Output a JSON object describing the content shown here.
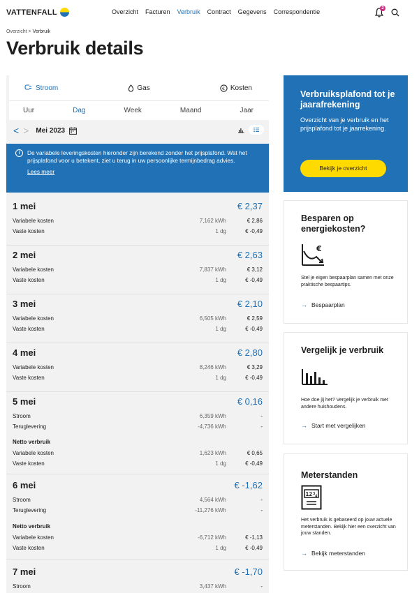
{
  "brand": {
    "name": "VATTENFALL"
  },
  "nav": [
    "Overzicht",
    "Facturen",
    "Verbruik",
    "Contract",
    "Gegevens",
    "Correspondentie"
  ],
  "notifications": {
    "count": "2"
  },
  "breadcrumb": {
    "parent": "Overzicht",
    "sep": ">",
    "current": "Verbruik"
  },
  "title": "Verbruik details",
  "energy_tabs": [
    "Stroom",
    "Gas",
    "Kosten"
  ],
  "period_tabs": [
    "Uur",
    "Dag",
    "Week",
    "Maand",
    "Jaar"
  ],
  "date": {
    "month": "Mei 2023",
    "prev": "<",
    "next": ">"
  },
  "info": {
    "text": "De variabele leveringskosten hieronder zijn berekend zonder het prijsplafond. Wat het prijsplafond voor u betekent, ziet u terug in uw persoonlijke termijnbedrag advies.",
    "link": "Lees meer"
  },
  "days": [
    {
      "title": "1 mei",
      "total": "€ 2,37",
      "lines": [
        {
          "label": "Variabele kosten",
          "qty": "7,162 kWh",
          "amount": "€ 2,86"
        },
        {
          "label": "Vaste kosten",
          "qty": "1 dg",
          "amount": "€ -0,49"
        }
      ]
    },
    {
      "title": "2 mei",
      "total": "€ 2,63",
      "lines": [
        {
          "label": "Variabele kosten",
          "qty": "7,837 kWh",
          "amount": "€ 3,12"
        },
        {
          "label": "Vaste kosten",
          "qty": "1 dg",
          "amount": "€ -0,49"
        }
      ]
    },
    {
      "title": "3 mei",
      "total": "€ 2,10",
      "lines": [
        {
          "label": "Variabele kosten",
          "qty": "6,505 kWh",
          "amount": "€ 2,59"
        },
        {
          "label": "Vaste kosten",
          "qty": "1 dg",
          "amount": "€ -0,49"
        }
      ]
    },
    {
      "title": "4 mei",
      "total": "€ 2,80",
      "lines": [
        {
          "label": "Variabele kosten",
          "qty": "8,246 kWh",
          "amount": "€ 3,29"
        },
        {
          "label": "Vaste kosten",
          "qty": "1 dg",
          "amount": "€ -0,49"
        }
      ]
    },
    {
      "title": "5 mei",
      "total": "€ 0,16",
      "usage": [
        {
          "label": "Stroom",
          "qty": "6,359 kWh",
          "amount": "-"
        },
        {
          "label": "Teruglevering",
          "qty": "-4,736 kWh",
          "amount": "-"
        }
      ],
      "net_label": "Netto verbruik",
      "lines": [
        {
          "label": "Variabele kosten",
          "qty": "1,623 kWh",
          "amount": "€ 0,65"
        },
        {
          "label": "Vaste kosten",
          "qty": "1 dg",
          "amount": "€ -0,49"
        }
      ]
    },
    {
      "title": "6 mei",
      "total": "€ -1,62",
      "usage": [
        {
          "label": "Stroom",
          "qty": "4,564 kWh",
          "amount": "-"
        },
        {
          "label": "Teruglevering",
          "qty": "-11,276 kWh",
          "amount": "-"
        }
      ],
      "net_label": "Netto verbruik",
      "lines": [
        {
          "label": "Variabele kosten",
          "qty": "-6,712 kWh",
          "amount": "€ -1,13"
        },
        {
          "label": "Vaste kosten",
          "qty": "1 dg",
          "amount": "€ -0,49"
        }
      ]
    },
    {
      "title": "7 mei",
      "total": "€ -1,70",
      "usage": [
        {
          "label": "Stroom",
          "qty": "3,437 kWh",
          "amount": "-"
        }
      ]
    }
  ],
  "sidebar": {
    "plafond": {
      "title": "Verbruiksplafond tot je jaarafrekening",
      "text": "Overzicht van je verbruik en het prijsplafond tot je jaarrekening.",
      "button": "Bekijk je overzicht"
    },
    "besparen": {
      "title": "Besparen op energiekosten?",
      "text": "Stel je eigen bespaarplan samen met onze praktische bespaartips.",
      "link": "Bespaarplan"
    },
    "vergelijk": {
      "title": "Vergelijk je verbruik",
      "text": "Hoe doe jij het? Vergelijk je verbruik met andere huishoudens.",
      "link": "Start met vergelijken"
    },
    "meterstanden": {
      "title": "Meterstanden",
      "text": "Het verbruik is gebaseerd op jouw actuele meterstanden. Bekijk hier een overzicht van jouw standen.",
      "link": "Bekijk meterstanden",
      "meter_digits": "12 3 4"
    }
  },
  "colors": {
    "brand_blue": "#2071b5",
    "yellow": "#ffda00",
    "badge": "#cc2b7f"
  }
}
